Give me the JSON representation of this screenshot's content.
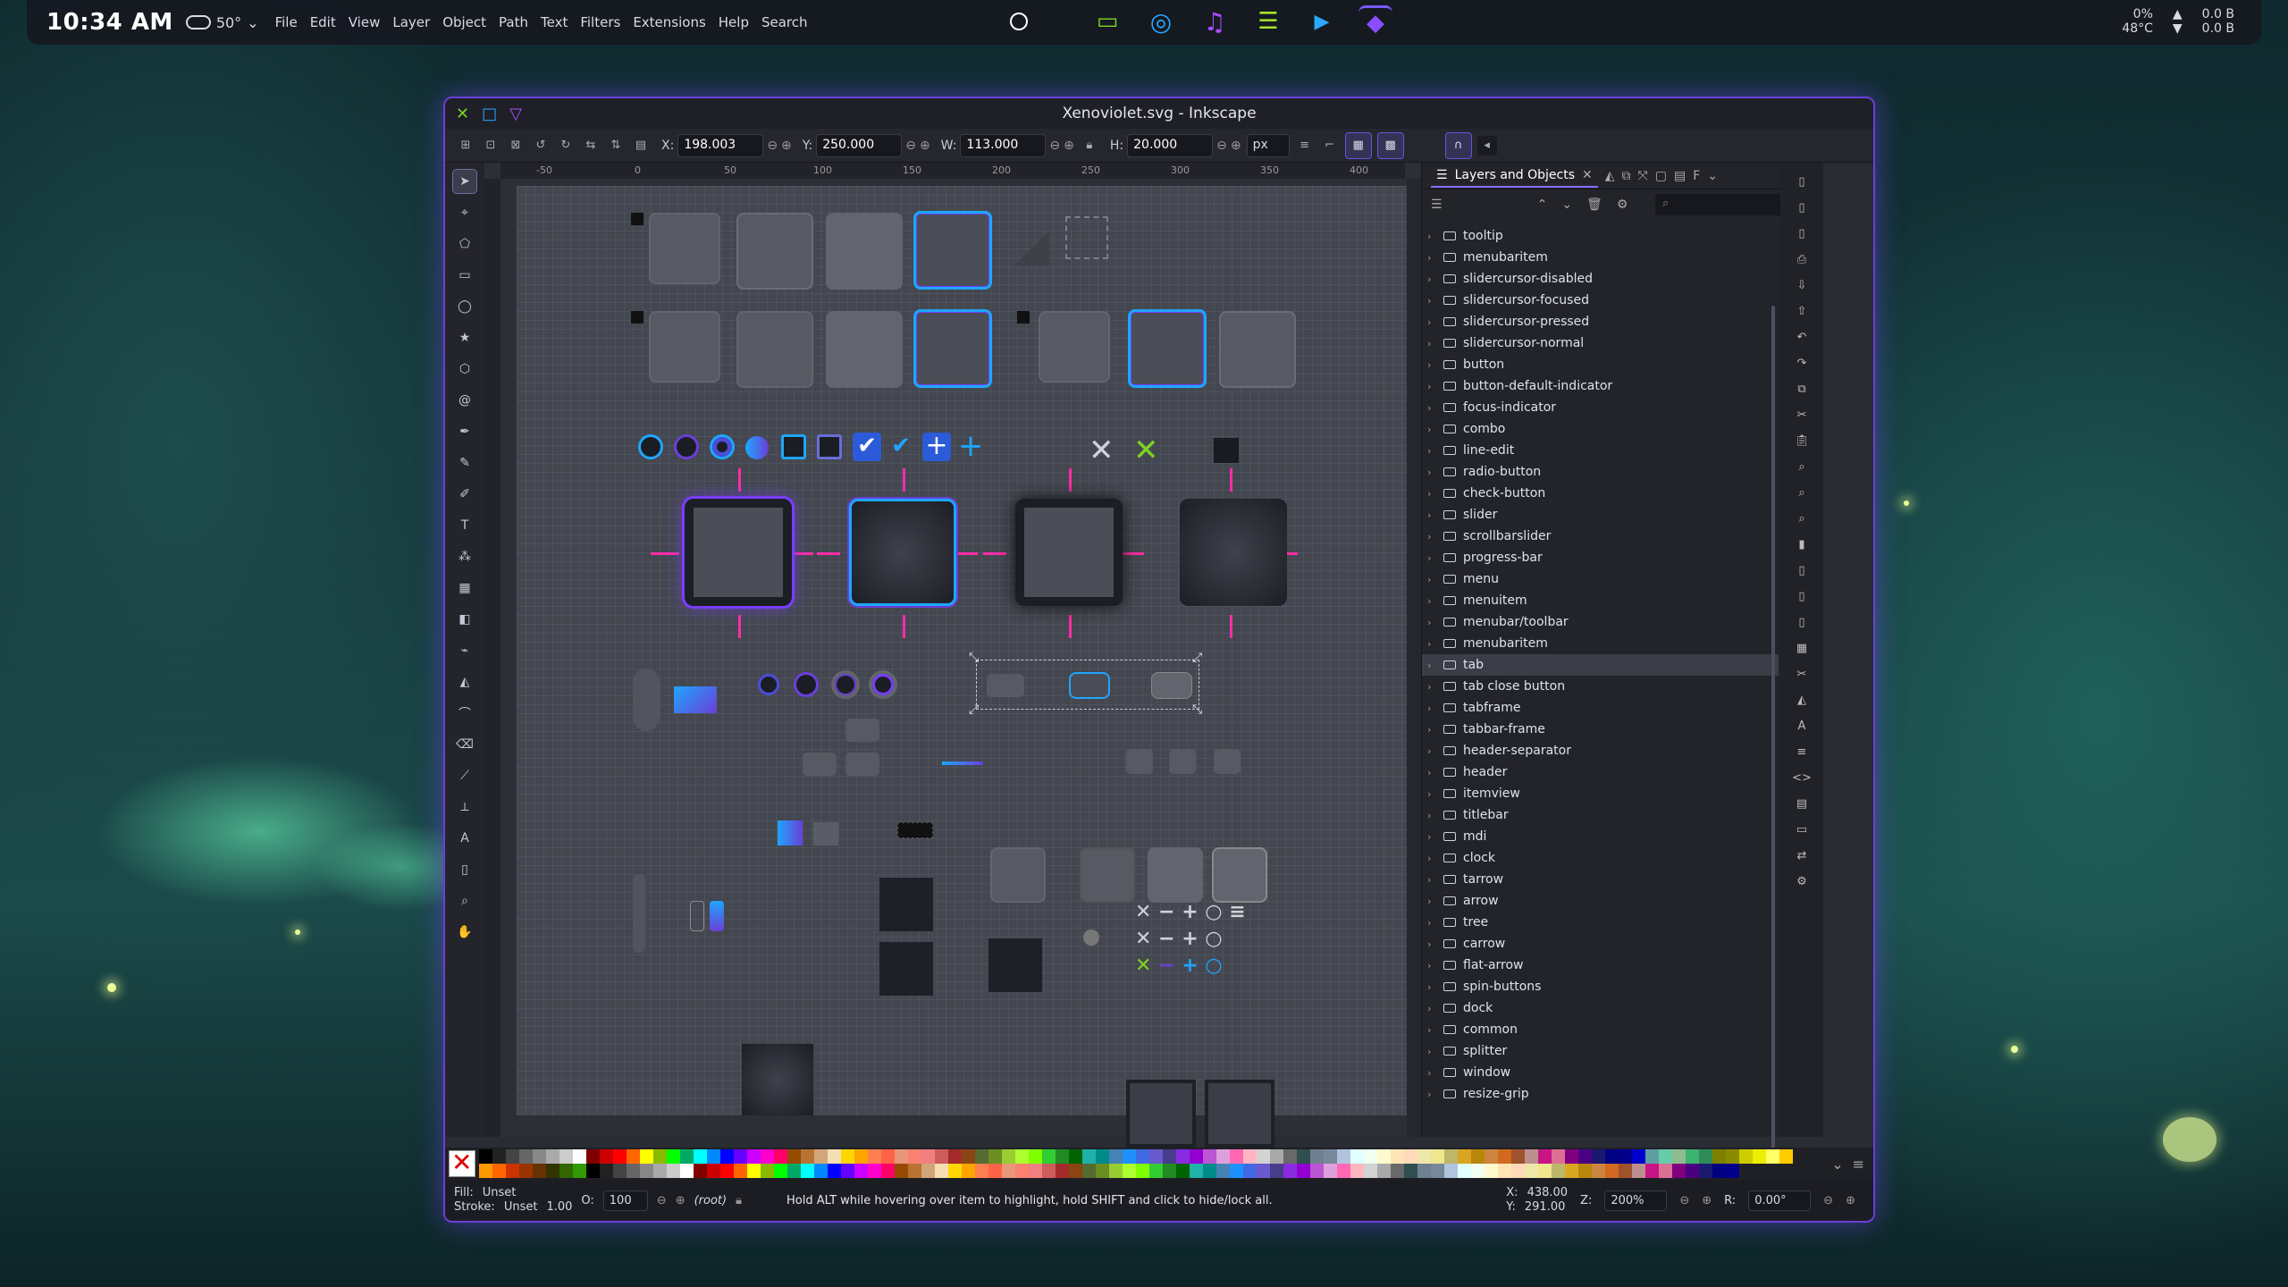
{
  "topbar": {
    "clock": "10:34 AM",
    "weather_temp": "50°",
    "menu": [
      "File",
      "Edit",
      "View",
      "Layer",
      "Object",
      "Path",
      "Text",
      "Filters",
      "Extensions",
      "Help",
      "Search"
    ],
    "sys": {
      "cpu": "0%",
      "temp": "48°C",
      "net_up": "0.0 B",
      "net_down": "0.0 B"
    }
  },
  "window": {
    "title": "Xenoviolet.svg - Inkscape"
  },
  "tool_controls": {
    "x_label": "X:",
    "x_value": "198.003",
    "y_label": "Y:",
    "y_value": "250.000",
    "w_label": "W:",
    "w_value": "113.000",
    "h_label": "H:",
    "h_value": "20.000",
    "unit": "px"
  },
  "rulers": {
    "h_ticks": [
      "-50",
      "0",
      "50",
      "100",
      "150",
      "200",
      "250",
      "300",
      "350",
      "400"
    ]
  },
  "dock": {
    "tab_label": "Layers and Objects",
    "layers": [
      "tooltip",
      "menubaritem",
      "slidercursor-disabled",
      "slidercursor-focused",
      "slidercursor-pressed",
      "slidercursor-normal",
      "button",
      "button-default-indicator",
      "focus-indicator",
      "combo",
      "line-edit",
      "radio-button",
      "check-button",
      "slider",
      "scrollbarslider",
      "progress-bar",
      "menu",
      "menuitem",
      "menubar/toolbar",
      "menubaritem",
      "tab",
      "tab close button",
      "tabframe",
      "tabbar-frame",
      "header-separator",
      "header",
      "itemview",
      "titlebar",
      "mdi",
      "clock",
      "tarrow",
      "arrow",
      "tree",
      "carrow",
      "flat-arrow",
      "spin-buttons",
      "dock",
      "common",
      "splitter",
      "window",
      "resize-grip"
    ],
    "selected_layer": "tab"
  },
  "status": {
    "fill_label": "Fill:",
    "fill_value": "Unset",
    "stroke_label": "Stroke:",
    "stroke_value": "Unset",
    "stroke_width": "1.00",
    "opacity_label": "O:",
    "opacity_value": "100",
    "layer": "(root)",
    "message": "Hold ALT while hovering over item to highlight, hold SHIFT and click to hide/lock all.",
    "cursor_x_label": "X:",
    "cursor_x": "438.00",
    "cursor_y_label": "Y:",
    "cursor_y": "291.00",
    "zoom_label": "Z:",
    "zoom": "200%",
    "rotate_label": "R:",
    "rotation": "0.00°"
  },
  "colors": {
    "accent": "#1ea6ff",
    "violet": "#6a3fd8",
    "magenta": "#ff2da8",
    "check": "#7ed321"
  }
}
